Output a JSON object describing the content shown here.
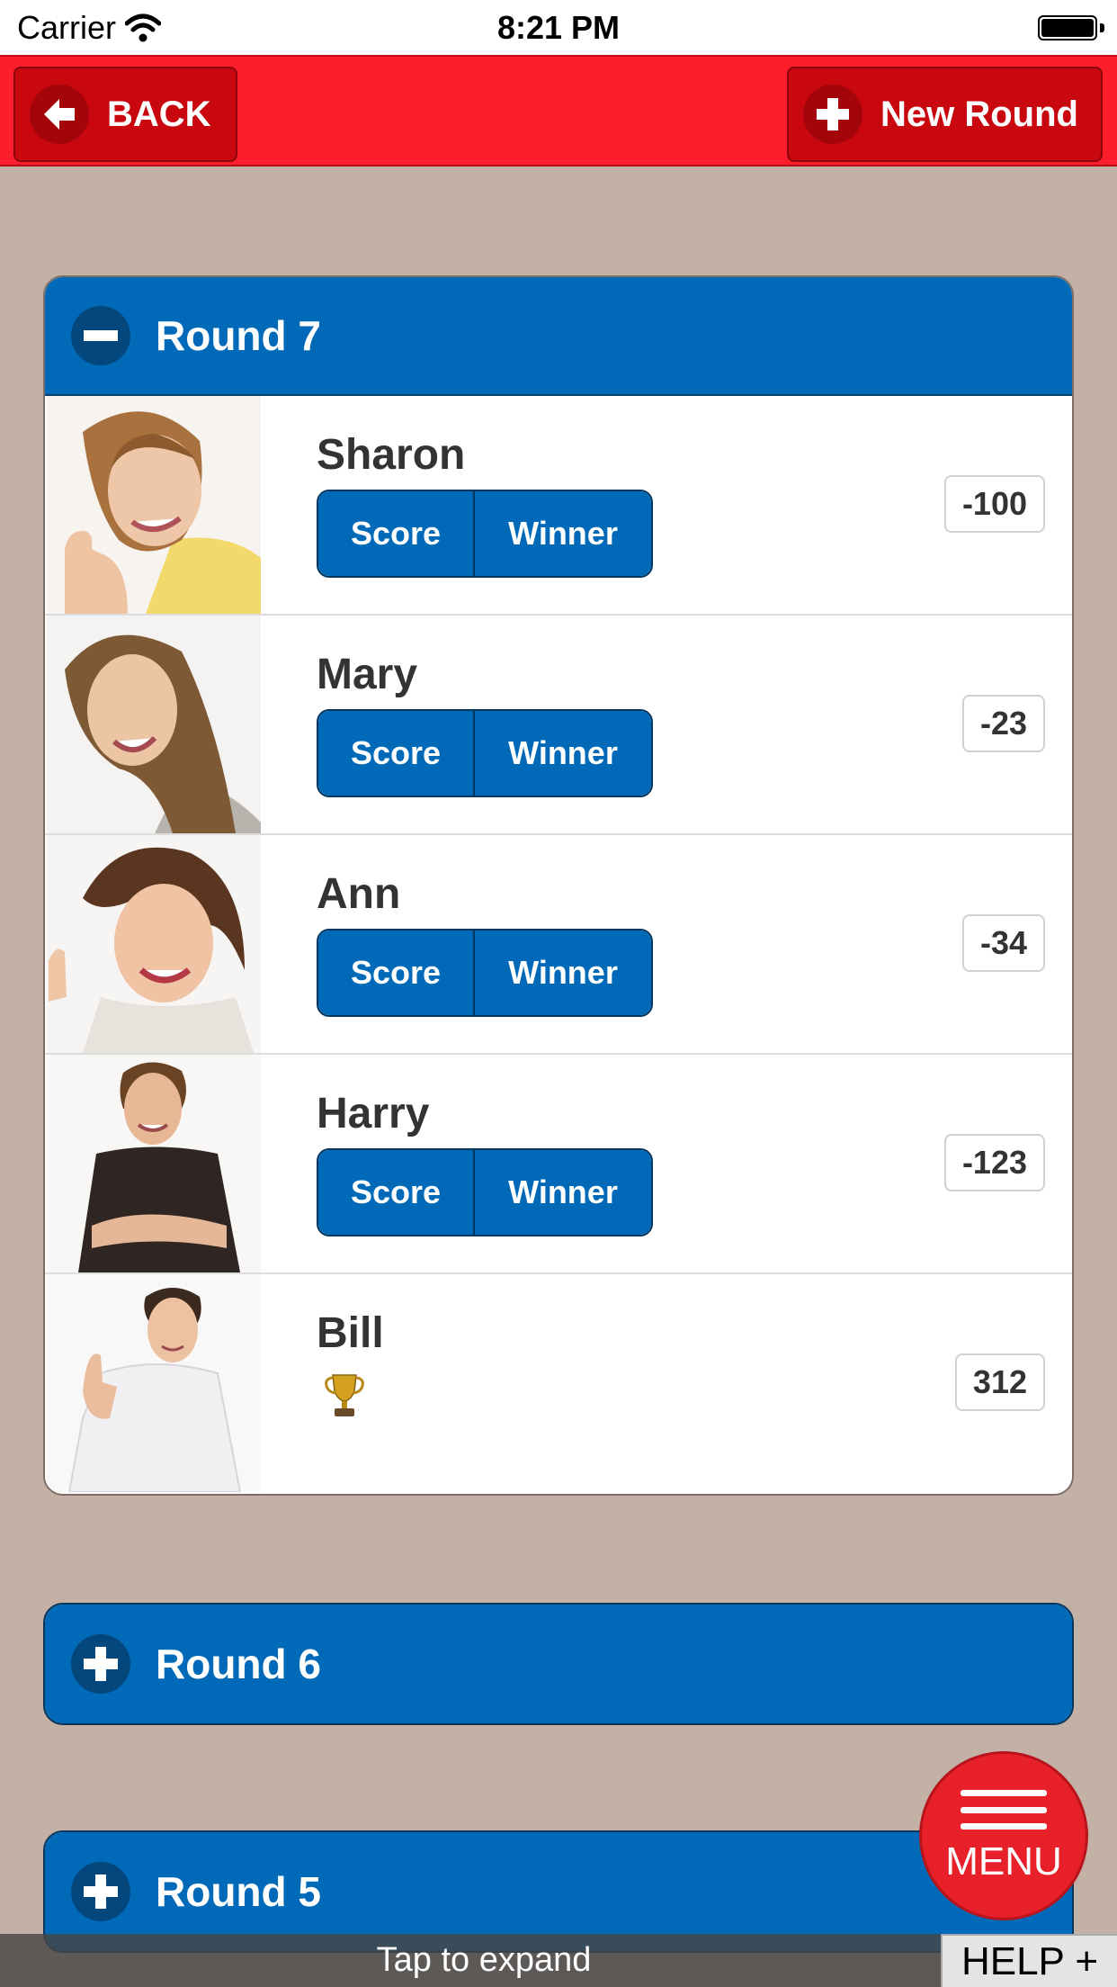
{
  "status_bar": {
    "carrier": "Carrier",
    "time": "8:21 PM"
  },
  "header": {
    "back_label": "BACK",
    "new_round_label": "New Round"
  },
  "rounds": [
    {
      "title": "Round 7",
      "expanded": true,
      "players": [
        {
          "name": "Sharon",
          "score": "-100",
          "score_label": "Score",
          "winner_label": "Winner",
          "is_winner": false
        },
        {
          "name": "Mary",
          "score": "-23",
          "score_label": "Score",
          "winner_label": "Winner",
          "is_winner": false
        },
        {
          "name": "Ann",
          "score": "-34",
          "score_label": "Score",
          "winner_label": "Winner",
          "is_winner": false
        },
        {
          "name": "Harry",
          "score": "-123",
          "score_label": "Score",
          "winner_label": "Winner",
          "is_winner": false
        },
        {
          "name": "Bill",
          "score": "312",
          "is_winner": true
        }
      ]
    },
    {
      "title": "Round 6",
      "expanded": false
    },
    {
      "title": "Round 5",
      "expanded": false
    }
  ],
  "menu": {
    "label": "MENU"
  },
  "footer": {
    "hint": "Tap to expand",
    "help_label": "HELP +"
  },
  "colors": {
    "header_red": "#fc1f2b",
    "accent_blue": "#0069b8",
    "background": "#c4b1a6"
  }
}
